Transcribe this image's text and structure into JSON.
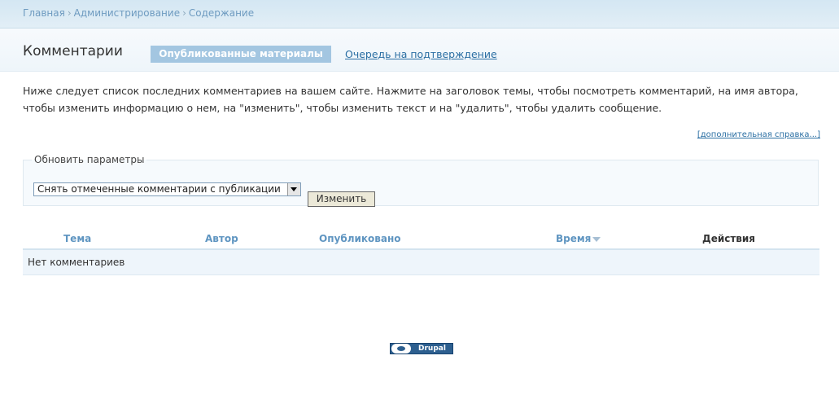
{
  "breadcrumb": [
    "Главная",
    "Администрирование",
    "Содержание"
  ],
  "page": {
    "title": "Комментарии",
    "tabs": [
      {
        "label": "Опубликованные материалы",
        "active": true
      },
      {
        "label": "Очередь на подтверждение",
        "active": false
      }
    ],
    "help": "Ниже следует список последних комментариев на вашем сайте. Нажмите на заголовок темы, чтобы посмотреть комментарий, на имя автора, чтобы изменить информацию о нем, на \"изменить\", чтобы изменить текст и на \"удалить\", чтобы удалить сообщение.",
    "more_help": "[дополнительная справка...]"
  },
  "options": {
    "legend": "Обновить параметры",
    "selected": "Снять отмеченные комментарии с публикации",
    "submit": "Изменить"
  },
  "table": {
    "headers": [
      "Тема",
      "Автор",
      "Опубликовано",
      "Время",
      "Действия"
    ],
    "empty": "Нет комментариев"
  },
  "footer": {
    "badge": "Drupal"
  },
  "colors": {
    "accent": "#a3c6e1",
    "link": "#2b6fa3",
    "header_link": "#5f95c1"
  }
}
